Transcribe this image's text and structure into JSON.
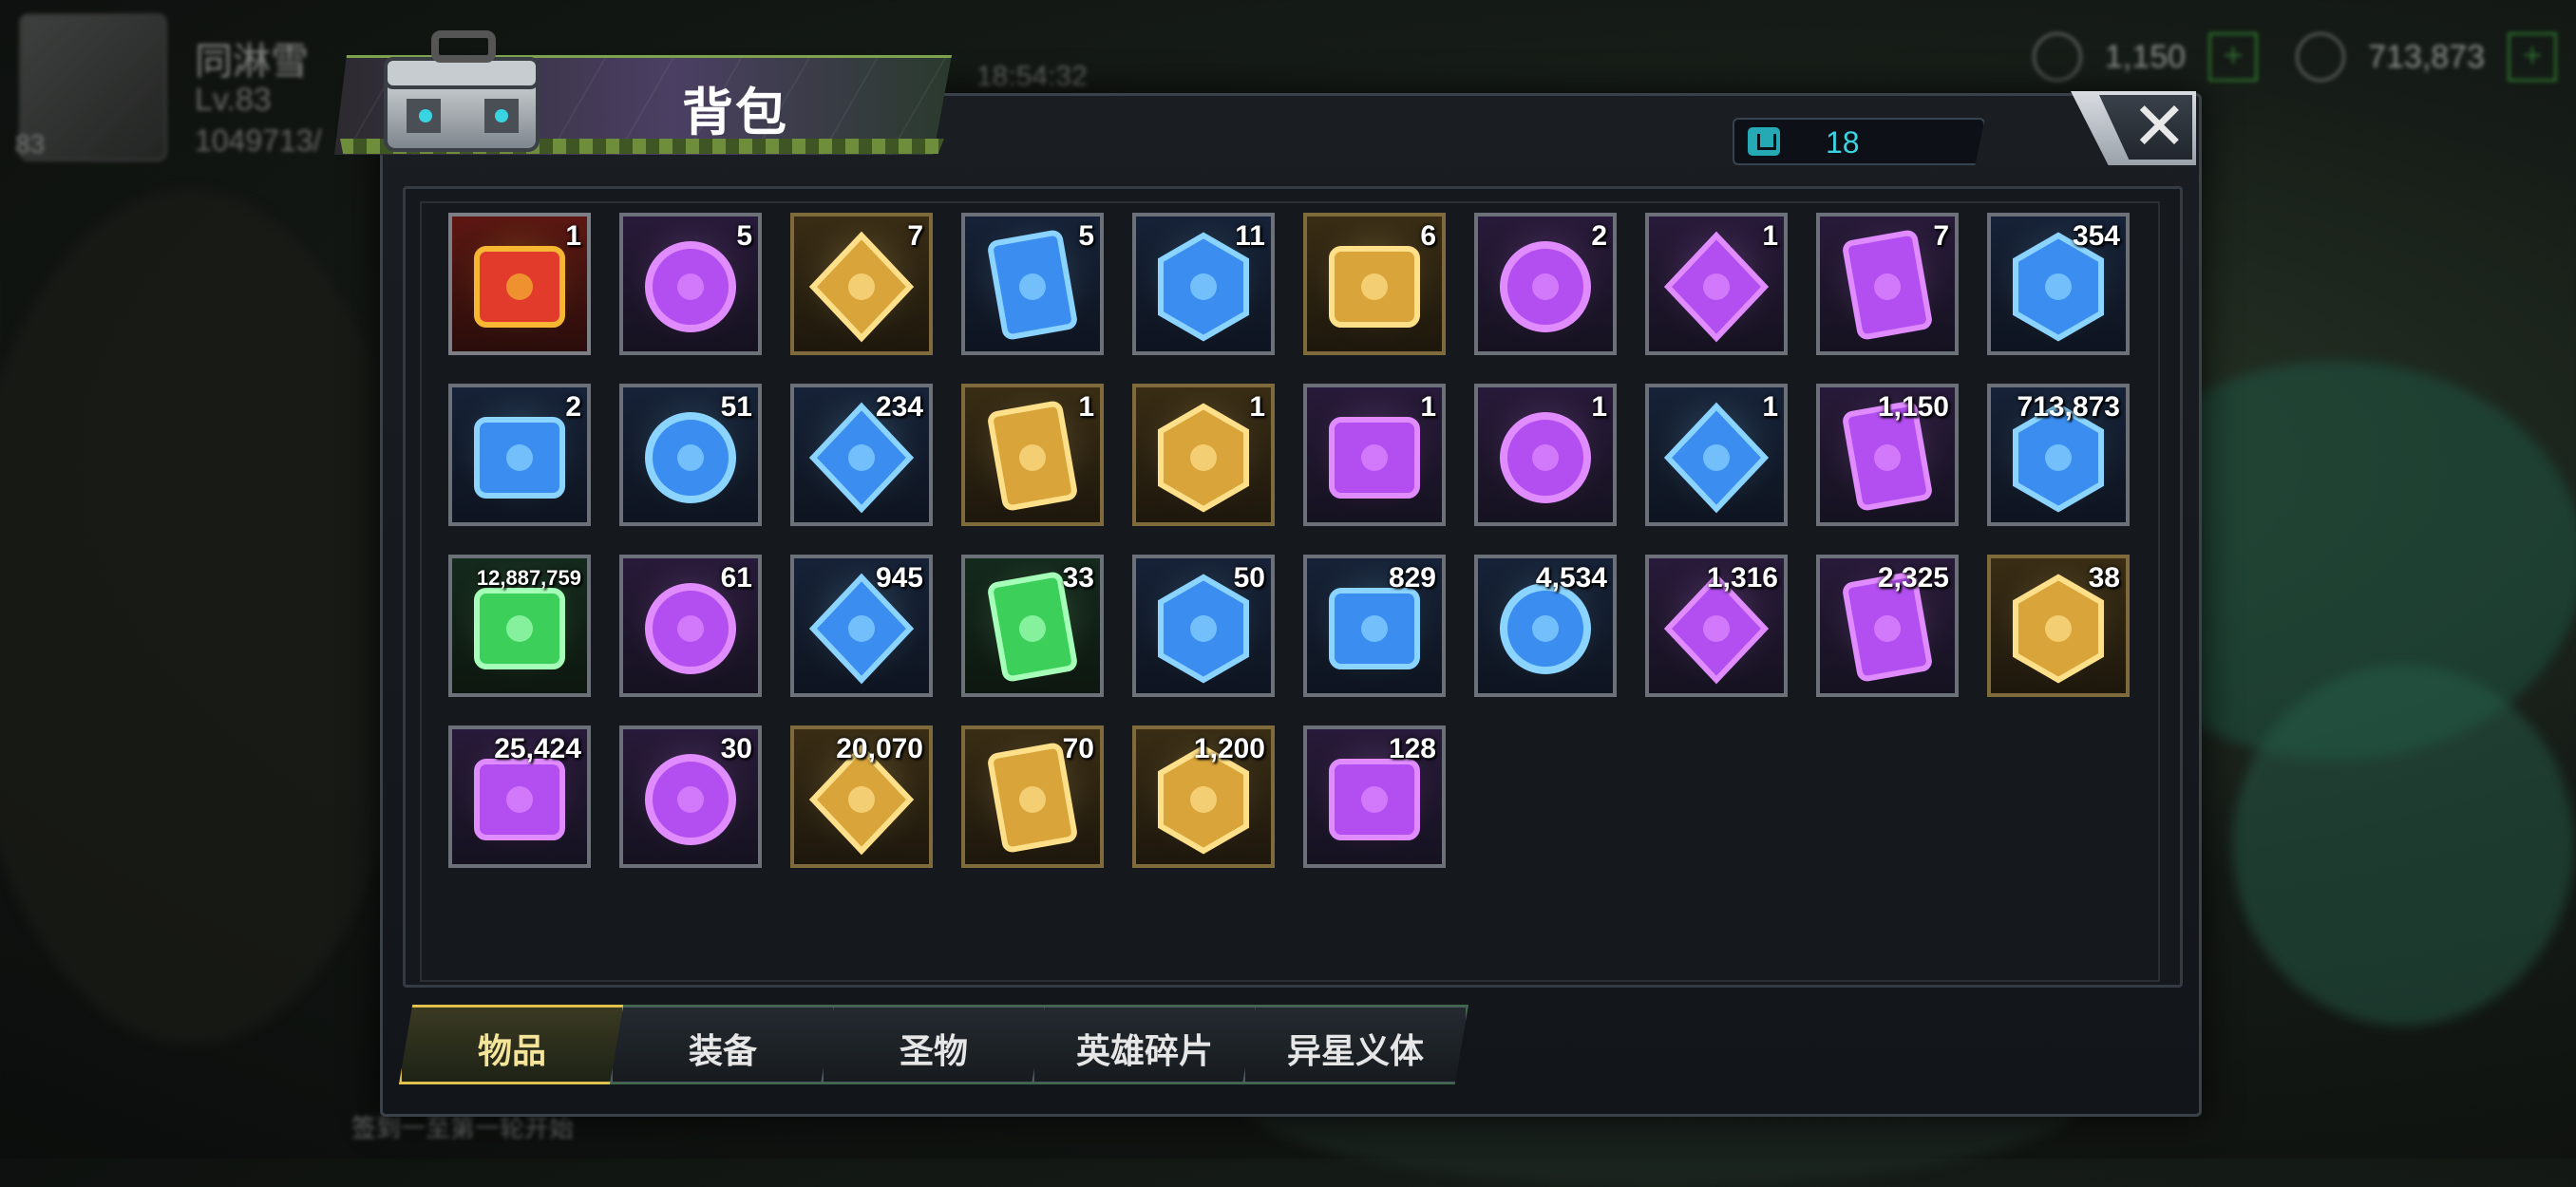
{
  "background": {
    "player_name": "同淋雪",
    "player_level": "Lv.83",
    "player_power": "1049713/",
    "level_badge": "83",
    "time": "18:54:32",
    "resource_1": "1,150",
    "resource_2": "713,873",
    "chat_hint": "签到一至第一轮开始"
  },
  "panel": {
    "title": "背包",
    "bag_count": "18",
    "close_label": "✕"
  },
  "items": [
    {
      "count": "1",
      "quality": "red",
      "icon": "sss-chest-icon"
    },
    {
      "count": "5",
      "quality": "purple",
      "icon": "rotation-device-icon"
    },
    {
      "count": "7",
      "quality": "gold",
      "icon": "24h-speedup-card-icon"
    },
    {
      "count": "5",
      "quality": "blue",
      "icon": "4h-speedup-card-icon"
    },
    {
      "count": "11",
      "quality": "blue",
      "icon": "4h-gold-card-icon"
    },
    {
      "count": "6",
      "quality": "gold",
      "icon": "demon-mask-icon"
    },
    {
      "count": "2",
      "quality": "purple",
      "icon": "film-reel-icon"
    },
    {
      "count": "1",
      "quality": "purple",
      "icon": "bottle-cap-s-icon"
    },
    {
      "count": "7",
      "quality": "purple",
      "icon": "police-badge-icon"
    },
    {
      "count": "354",
      "quality": "blue",
      "icon": "cinema-ticket-icon"
    },
    {
      "count": "2",
      "quality": "blue",
      "icon": "bottle-cap-b-icon"
    },
    {
      "count": "51",
      "quality": "blue",
      "icon": "casino-chip-icon"
    },
    {
      "count": "234",
      "quality": "blue",
      "icon": "bullet-icon"
    },
    {
      "count": "1",
      "quality": "gold",
      "icon": "blueprint-swords-icon"
    },
    {
      "count": "1",
      "quality": "gold",
      "icon": "blueprint-revolver-icon"
    },
    {
      "count": "1",
      "quality": "purple",
      "icon": "blueprint-pistol-icon"
    },
    {
      "count": "1",
      "quality": "purple",
      "icon": "blueprint-shirt-icon"
    },
    {
      "count": "1",
      "quality": "blue",
      "icon": "blueprint-boot-icon"
    },
    {
      "count": "1,150",
      "quality": "purple",
      "icon": "purple-gem-icon"
    },
    {
      "count": "713,873",
      "quality": "blue",
      "icon": "gold-coins-icon"
    },
    {
      "count": "12,887,759",
      "quality": "green",
      "icon": "green-battery-icon",
      "small": true
    },
    {
      "count": "61",
      "quality": "purple",
      "icon": "purple-orb-icon"
    },
    {
      "count": "945",
      "quality": "blue",
      "icon": "gear-icon"
    },
    {
      "count": "33",
      "quality": "green",
      "icon": "red-node-coin-icon"
    },
    {
      "count": "50",
      "quality": "blue",
      "icon": "eye-badge-icon"
    },
    {
      "count": "829",
      "quality": "blue",
      "icon": "crystal-shard-icon"
    },
    {
      "count": "4,534",
      "quality": "blue",
      "icon": "fist-emblem-icon"
    },
    {
      "count": "1,316",
      "quality": "purple",
      "icon": "puzzle-piece-icon"
    },
    {
      "count": "2,325",
      "quality": "purple",
      "icon": "ship-medal-icon"
    },
    {
      "count": "38",
      "quality": "gold",
      "icon": "gold-ship-medal-icon"
    },
    {
      "count": "25,424",
      "quality": "purple",
      "icon": "biohazard-gem-icon"
    },
    {
      "count": "30",
      "quality": "purple",
      "icon": "lightning-coin-icon"
    },
    {
      "count": "20,070",
      "quality": "gold",
      "icon": "crimson-crystal-icon"
    },
    {
      "count": "70",
      "quality": "gold",
      "icon": "gold-token-icon"
    },
    {
      "count": "1,200",
      "quality": "gold",
      "icon": "silver-medallion-icon"
    },
    {
      "count": "128",
      "quality": "purple",
      "icon": "dna-helix-icon"
    }
  ],
  "tabs": [
    {
      "label": "物品",
      "active": true
    },
    {
      "label": "装备",
      "active": false
    },
    {
      "label": "圣物",
      "active": false
    },
    {
      "label": "英雄碎片",
      "active": false
    },
    {
      "label": "异星义体",
      "active": false
    }
  ],
  "colors": {
    "accent_green": "#7da14f",
    "tab_active": "#d7b94a",
    "bag_count": "#39d3e1"
  }
}
